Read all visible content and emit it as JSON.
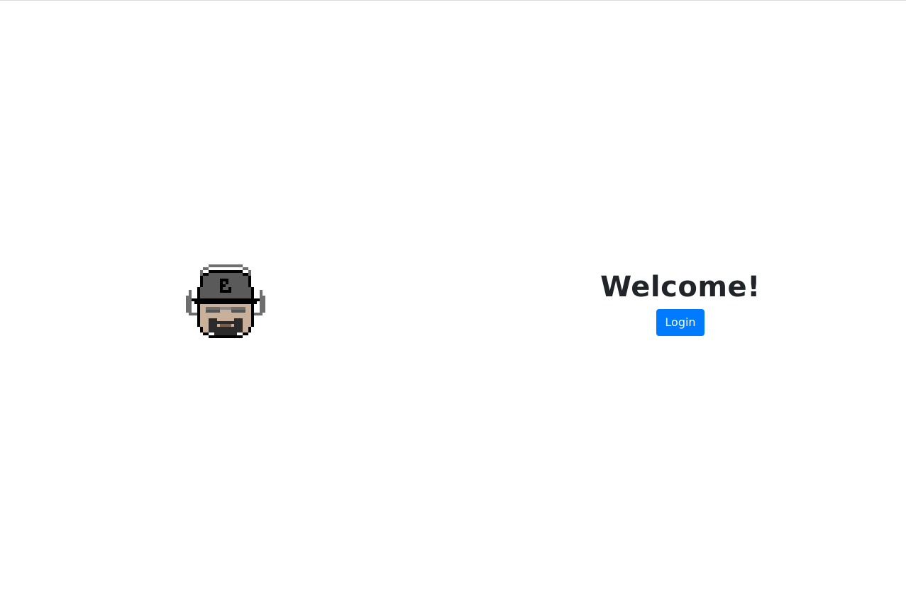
{
  "welcome": {
    "title": "Welcome!",
    "login_label": "Login"
  },
  "avatar": {
    "icon": "pixel-art-avatar-icon"
  },
  "colors": {
    "primary": "#007bff",
    "text": "#212529",
    "skin": "#c8b09a",
    "cap": "#5a5a5a",
    "outline": "#000000"
  }
}
